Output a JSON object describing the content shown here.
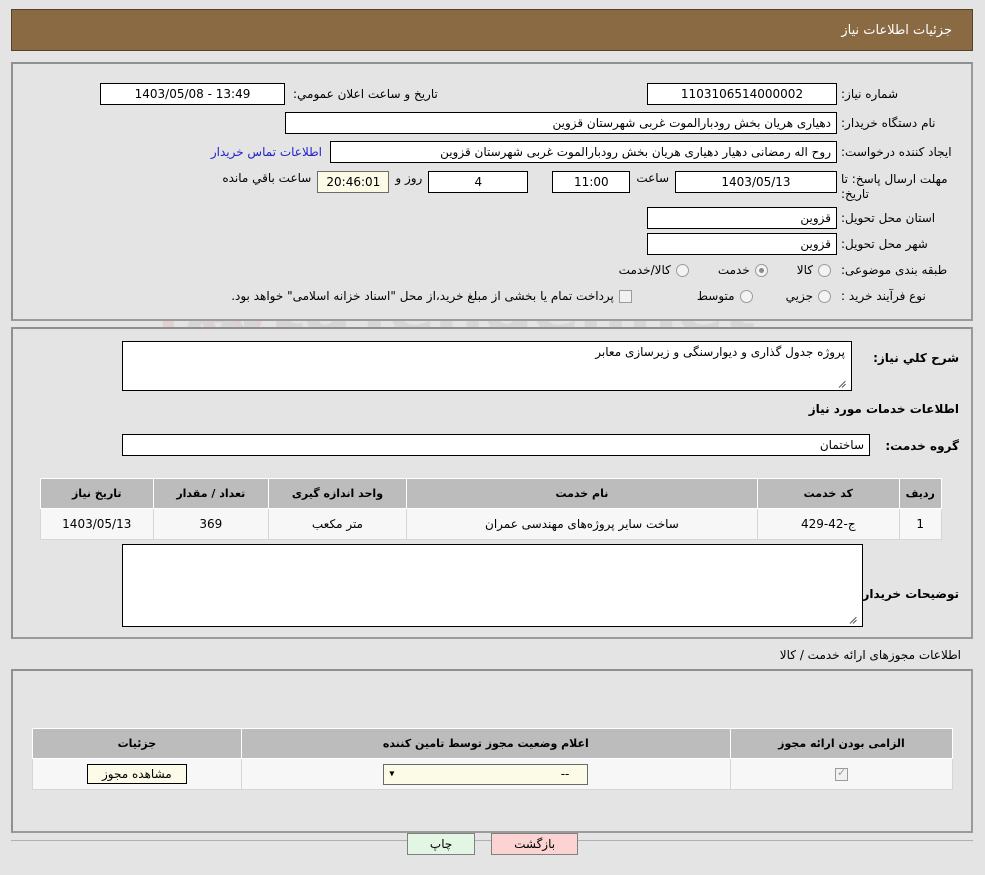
{
  "header": {
    "title": "جزئیات اطلاعات نیاز"
  },
  "form": {
    "need_number_label": "شماره نیاز:",
    "need_number_value": "1103106514000002",
    "announce_label": "تاریخ و ساعت اعلان عمومي:",
    "announce_value": "13:49 - 1403/05/08",
    "buyer_org_label": "نام دستگاه خریدار:",
    "buyer_org_value": "دهیاری هریان بخش رودبارالموت غربی شهرستان قزوین",
    "creator_label": "ایجاد کننده درخواست:",
    "creator_value": "روح اله رمضانی دهیار دهیاری هریان بخش رودبارالموت غربی شهرستان قزوین",
    "contact_link": "اطلاعات تماس خریدار",
    "deadline_label": "مهلت ارسال پاسخ: تا تاریخ:",
    "deadline_date": "1403/05/13",
    "deadline_hour_label": "ساعت",
    "deadline_hour": "11:00",
    "remaining_days": "4",
    "remaining_days_label": "روز و",
    "remaining_time": "20:46:01",
    "remaining_time_label": "ساعت باقي مانده",
    "province_label": "استان محل تحویل:",
    "province_value": "قزوین",
    "city_label": "شهر محل تحویل:",
    "city_value": "قزوین",
    "category_label": "طبقه بندی موضوعی:",
    "category_options": [
      {
        "label": "کالا",
        "selected": false
      },
      {
        "label": "خدمت",
        "selected": true
      },
      {
        "label": "کالا/خدمت",
        "selected": false
      }
    ],
    "process_label": "نوع فرآیند خرید :",
    "process_options": [
      {
        "label": "جزیي",
        "selected": false
      },
      {
        "label": "متوسط",
        "selected": false
      }
    ],
    "treasury_checkbox_checked": false,
    "treasury_text": "پرداخت تمام یا بخشی از مبلغ خرید،از محل \"اسناد خزانه اسلامی\" خواهد بود."
  },
  "description": {
    "need_desc_label": "شرح کلي نیاز:",
    "need_desc_value": "پروژه جدول گذاری و دیوارسنگی و زیرسازی معابر",
    "services_title": "اطلاعات خدمات مورد نیاز",
    "service_group_label": "گروه خدمت:",
    "service_group_value": "ساختمان",
    "buyer_notes_label": "توضیحات خریدار:",
    "buyer_notes_value": ""
  },
  "services_table": {
    "headers": [
      "ردیف",
      "کد خدمت",
      "نام خدمت",
      "واحد اندازه گیری",
      "تعداد / مقدار",
      "تاریخ نیاز"
    ],
    "rows": [
      {
        "row_no": "1",
        "service_code": "ج-42-429",
        "service_name": "ساخت سایر پروژه‌های مهندسی عمران",
        "unit": "متر مکعب",
        "quantity": "369",
        "need_date": "1403/05/13"
      }
    ]
  },
  "permits": {
    "section_title": "اطلاعات مجوزهای ارائه خدمت / کالا",
    "headers": [
      "الزامی بودن ارائه مجوز",
      "اعلام وضعیت مجوز توسط تامین کننده",
      "جزئیات"
    ],
    "rows": [
      {
        "required_checked": true,
        "status_value": "--",
        "details_button": "مشاهده مجوز"
      }
    ]
  },
  "footer": {
    "print_button": "چاپ",
    "back_button": "بازگشت"
  },
  "watermark": {
    "text": "ArtaTender.net"
  },
  "colors": {
    "header_bg": "#8a6a42",
    "page_bg": "#e4e4e4",
    "link": "#2222cc",
    "table_header": "#bcbcbc",
    "print_btn": "#e3f5e3",
    "back_btn": "#fbd3d3"
  }
}
